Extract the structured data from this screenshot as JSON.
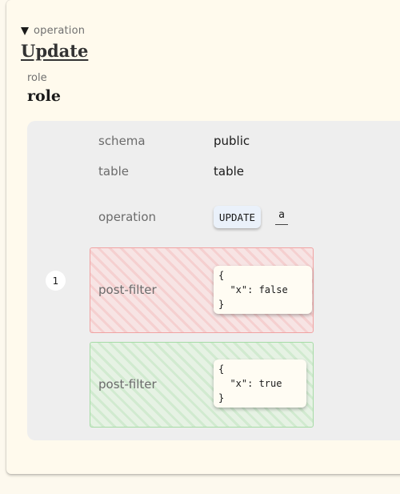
{
  "header": {
    "toggle_label": "operation",
    "title": "Update"
  },
  "role": {
    "label": "role",
    "value": "role"
  },
  "details": {
    "schema_label": "schema",
    "schema_value": "public",
    "table_label": "table",
    "table_value": "table",
    "operation_label": "operation",
    "operation_value": "UPDATE",
    "operation_alias": "a"
  },
  "filters": {
    "index": "1",
    "failing": {
      "label": "post-filter",
      "code": [
        "{",
        "  \"x\": false",
        "}"
      ]
    },
    "passing": {
      "label": "post-filter",
      "code": [
        "{",
        "  \"x\": true",
        "}"
      ]
    }
  },
  "colors": {
    "background": "#fffaed",
    "panel": "#eeeeee",
    "fail_border": "#f0a3a3",
    "pass_border": "#a6dca6",
    "op_badge": "#eaf1fa"
  }
}
